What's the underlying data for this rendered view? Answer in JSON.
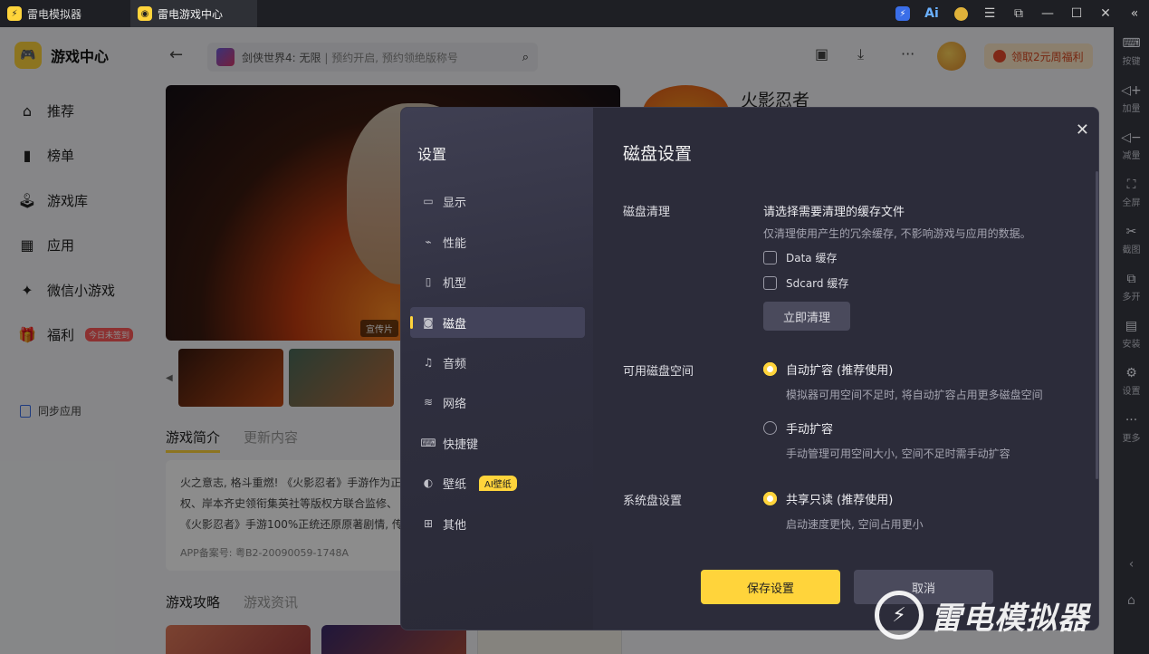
{
  "titlebar": {
    "tabs": [
      {
        "label": "雷电模拟器"
      },
      {
        "label": "雷电游戏中心"
      }
    ]
  },
  "sidebar": {
    "brand": "游戏中心",
    "items": [
      {
        "label": "推荐",
        "icon": "home-icon"
      },
      {
        "label": "榜单",
        "icon": "chart-icon"
      },
      {
        "label": "游戏库",
        "icon": "gamepad-icon"
      },
      {
        "label": "应用",
        "icon": "apps-icon"
      },
      {
        "label": "微信小游戏",
        "icon": "mini-game-icon"
      },
      {
        "label": "福利",
        "icon": "gift-icon",
        "badge": "今日未签到"
      }
    ],
    "sync": "同步应用"
  },
  "header": {
    "search_game": "剑侠世界4: 无限",
    "search_hint": "预约开启, 预约领绝版称号",
    "welfare": "领取2元周福利"
  },
  "content": {
    "banner_tag": "宣传片",
    "game_title": "火影忍者",
    "tabs": [
      "游戏简介",
      "更新内容"
    ],
    "intro_lines": [
      "火之意志, 格斗重燃! 《火影忍者》手游作为正",
      "权、岸本齐史领衔集英社等版权方联合监修、",
      "《火影忍者》手游100%正统还原原著剧情, 传"
    ],
    "record": "APP备案号: 粤B2-20090059-1748A",
    "tabs2": [
      "游戏攻略",
      "游戏资讯"
    ]
  },
  "rail": [
    {
      "label": "按键",
      "icon": "keyboard-icon"
    },
    {
      "label": "加量",
      "icon": "volume-up-icon"
    },
    {
      "label": "减量",
      "icon": "volume-down-icon"
    },
    {
      "label": "全屏",
      "icon": "fullscreen-icon"
    },
    {
      "label": "截图",
      "icon": "scissors-icon"
    },
    {
      "label": "多开",
      "icon": "multi-instance-icon"
    },
    {
      "label": "安装",
      "icon": "install-icon"
    },
    {
      "label": "设置",
      "icon": "gear-icon"
    },
    {
      "label": "更多",
      "icon": "more-icon"
    }
  ],
  "dialog": {
    "title": "设置",
    "menu": [
      {
        "label": "显示",
        "icon": "monitor-icon"
      },
      {
        "label": "性能",
        "icon": "performance-icon"
      },
      {
        "label": "机型",
        "icon": "phone-icon"
      },
      {
        "label": "磁盘",
        "icon": "disk-icon",
        "active": true
      },
      {
        "label": "音频",
        "icon": "audio-icon"
      },
      {
        "label": "网络",
        "icon": "wifi-icon"
      },
      {
        "label": "快捷键",
        "icon": "keyboard-icon"
      },
      {
        "label": "壁纸",
        "icon": "palette-icon",
        "badge": "AI壁纸"
      },
      {
        "label": "其他",
        "icon": "grid-icon"
      }
    ],
    "heading": "磁盘设置",
    "disk_clean": {
      "label": "磁盘清理",
      "title": "请选择需要清理的缓存文件",
      "desc": "仅清理使用产生的冗余缓存, 不影响游戏与应用的数据。",
      "options": [
        "Data 缓存",
        "Sdcard 缓存"
      ],
      "button": "立即清理"
    },
    "disk_space": {
      "label": "可用磁盘空间",
      "auto_title": "自动扩容 (推荐使用)",
      "auto_desc": "模拟器可用空间不足时, 将自动扩容占用更多磁盘空间",
      "manual_title": "手动扩容",
      "manual_desc": "手动管理可用空间大小, 空间不足时需手动扩容"
    },
    "system_disk": {
      "label": "系统盘设置",
      "title": "共享只读 (推荐使用)",
      "desc": "启动速度更快, 空间占用更小"
    },
    "save": "保存设置",
    "cancel": "取消"
  },
  "watermark": "雷电模拟器",
  "colors": {
    "accent": "#ffd43b",
    "dialog_bg": "#2c2c3a",
    "sidebar_bg": "#f4f5f7"
  }
}
